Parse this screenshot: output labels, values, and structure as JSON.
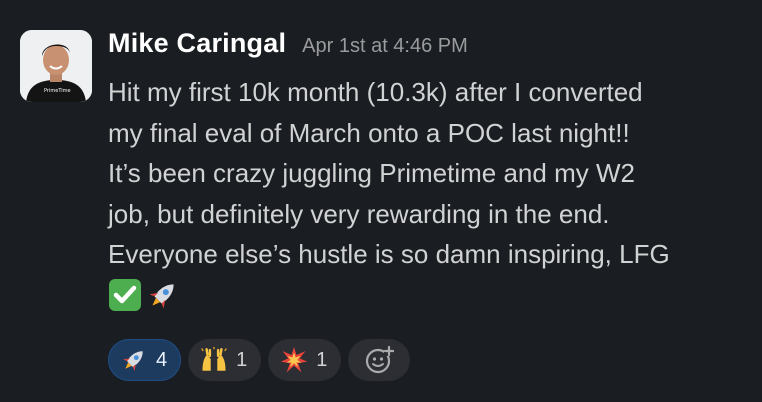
{
  "message": {
    "sender": "Mike Caringal",
    "timestamp": "Apr 1st at 4:46 PM",
    "lines": [
      "Hit my first 10k month (10.3k) after I converted",
      "my final eval of March onto a POC last night!!",
      "It’s been crazy juggling Primetime and my W2",
      "job, but definitely very rewarding in the end.",
      "Everyone else’s hustle is so damn inspiring, LFG"
    ],
    "trailing_emojis": [
      "check-mark-button",
      "rocket"
    ],
    "avatar_shirt_text": "PrimeTime"
  },
  "reactions": [
    {
      "emoji": "rocket",
      "count": "4",
      "active": true
    },
    {
      "emoji": "raising-hands",
      "count": "1",
      "active": false
    },
    {
      "emoji": "collision",
      "count": "1",
      "active": false
    }
  ],
  "add_reaction": {
    "icon": "add-reaction-icon"
  },
  "colors": {
    "background": "#1a1d21",
    "active_reaction": "#1d3a5f",
    "reaction": "#2c2e33"
  }
}
